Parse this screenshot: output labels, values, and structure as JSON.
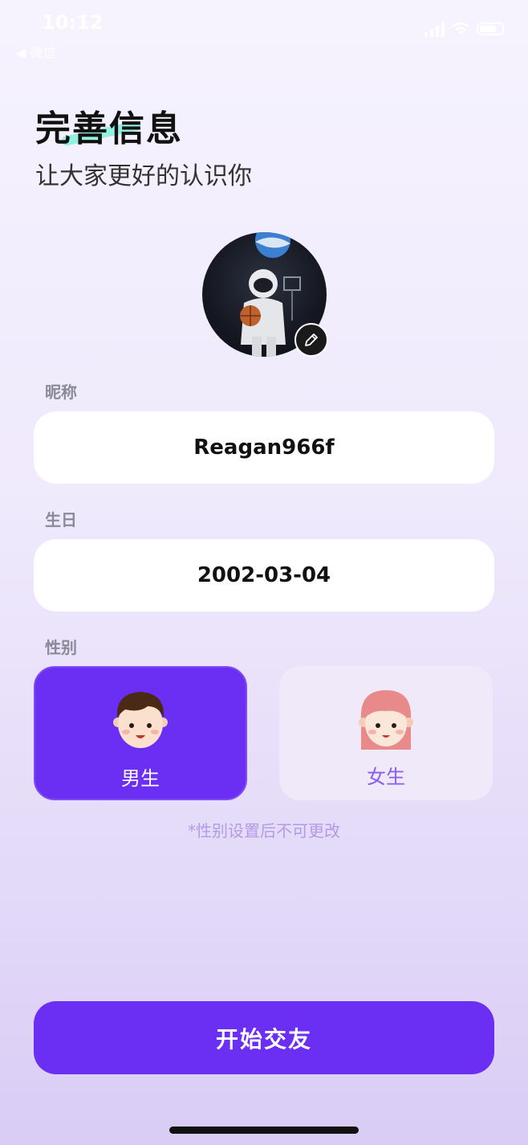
{
  "status": {
    "time": "10:12",
    "back_app": "◀ 微信"
  },
  "header": {
    "title": "完善信息",
    "subtitle": "让大家更好的认识你"
  },
  "avatar": {
    "icon": "astronaut-photo",
    "edit_icon": "pencil-icon"
  },
  "nickname": {
    "label": "昵称",
    "value": "Reagan966f"
  },
  "birthday": {
    "label": "生日",
    "value": "2002-03-04"
  },
  "gender": {
    "label": "性别",
    "options": [
      {
        "label": "男生",
        "selected": true,
        "icon": "boy-face-icon"
      },
      {
        "label": "女生",
        "selected": false,
        "icon": "girl-face-icon"
      }
    ],
    "note": "*性别设置后不可更改"
  },
  "cta": {
    "label": "开始交友"
  },
  "colors": {
    "accent": "#6a2ff2",
    "highlight": "#7ff0dc"
  }
}
